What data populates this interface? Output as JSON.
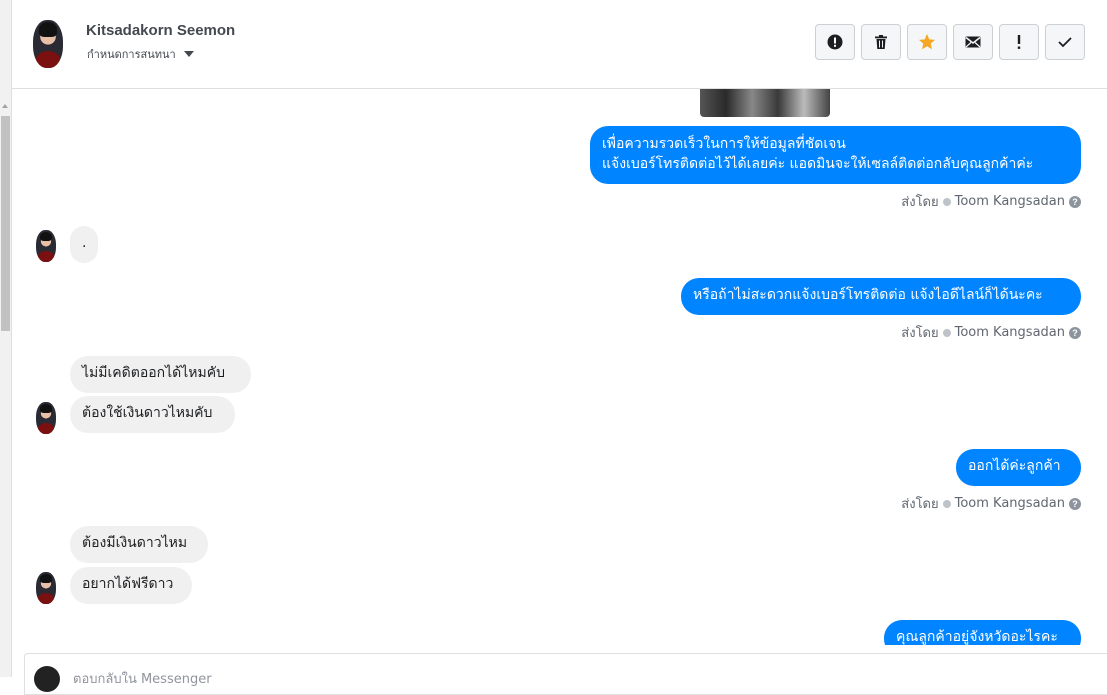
{
  "header": {
    "contact_name": "Kitsadakorn Seemon",
    "conversation_setting": "กำหนดการสนทนา",
    "toolbar": {
      "icons": [
        "alert-icon",
        "trash-icon",
        "star-icon",
        "mail-icon",
        "exclamation-icon",
        "check-icon"
      ],
      "star_color": "#f5a623"
    }
  },
  "messages": {
    "m1_line1": "เพื่อความรวดเร็วในการให้ข้อมูลที่ชัดเจน",
    "m1_line2": "แจ้งเบอร์โทรติดต่อไว้ได้เลยค่ะ แอดมินจะให้เซลล์ติดต่อกลับคุณลูกค้าค่ะ",
    "m2": ".",
    "m3": "หรือถ้าไม่สะดวกแจ้งเบอร์โทรติดต่อ แจ้งไอดีไลน์ก็ได้นะคะ",
    "m4": "ไม่มีเคดิตออกได้ไหมคับ",
    "m5": "ต้องใช้เงินดาวไหมคับ",
    "m6": "ออกได้ค่ะลูกค้า",
    "m7": "ต้องมีเงินดาวไหม",
    "m8": "อยากได้ฟรีดาว",
    "m9": "คุณลูกค้าอยู่จังหวัดอะไรคะ"
  },
  "sent_by": {
    "prefix": "ส่งโดย",
    "agent": "Toom Kangsadan",
    "help": "?"
  },
  "reply": {
    "placeholder": "ตอบกลับใน Messenger"
  },
  "colors": {
    "outgoing_bubble": "#0084ff",
    "incoming_bubble": "#f1f0f0"
  }
}
